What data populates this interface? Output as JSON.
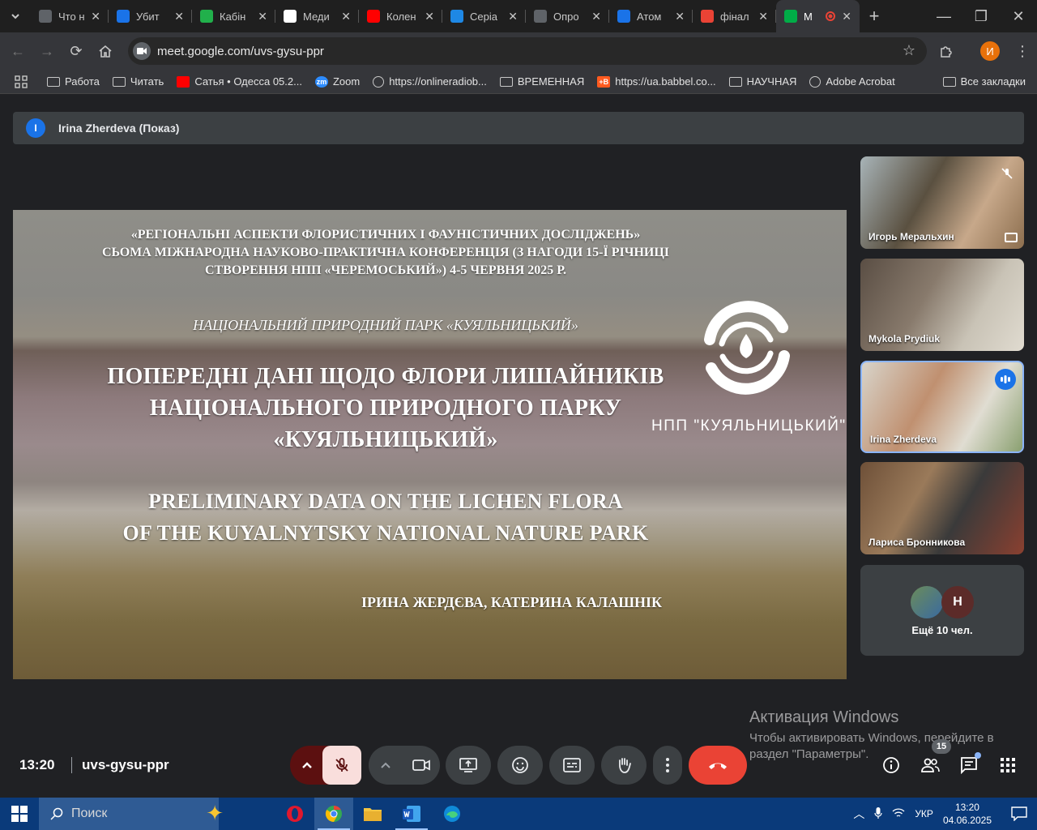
{
  "browser": {
    "tabs": [
      {
        "title": "Что н",
        "fav_color": "#5f6368"
      },
      {
        "title": "Убит",
        "fav_color": "#1a73e8"
      },
      {
        "title": "Кабін",
        "fav_color": "#21b04b"
      },
      {
        "title": "Меди",
        "fav_color": "#ffffff"
      },
      {
        "title": "Колен",
        "fav_color": "#ff0000"
      },
      {
        "title": "Серіа",
        "fav_color": "#1e88e5"
      },
      {
        "title": "Опро",
        "fav_color": "#5f6368"
      },
      {
        "title": "Атом",
        "fav_color": "#1a73e8"
      },
      {
        "title": "фінал",
        "fav_color": "#ea4335"
      },
      {
        "title": "М",
        "fav_color": "#00ac47"
      }
    ],
    "url": "meet.google.com/uvs-gysu-ppr",
    "profile_initial": "И",
    "bookmarks": [
      {
        "label": "Работа",
        "icon": "folder-icon"
      },
      {
        "label": "Читать",
        "icon": "folder-icon"
      },
      {
        "label": "Сатья • Одесса 05.2...",
        "icon": "youtube-icon",
        "color": "#ff0000"
      },
      {
        "label": "Zoom",
        "icon": "zoom-icon",
        "color": "#2d8cff",
        "badge": "zm"
      },
      {
        "label": "https://onlineradiob...",
        "icon": "radio-icon"
      },
      {
        "label": "ВРЕМЕННАЯ",
        "icon": "folder-icon"
      },
      {
        "label": "https://ua.babbel.co...",
        "icon": "babbel-icon",
        "color": "#ff5a1f",
        "badge": "+B"
      },
      {
        "label": "НАУЧНАЯ",
        "icon": "folder-icon"
      },
      {
        "label": "Adobe Acrobat",
        "icon": "globe-icon"
      }
    ],
    "all_bookmarks": "Все закладки"
  },
  "meet": {
    "presenter_initial": "I",
    "presenter_label": "Irina Zherdeva (Показ)",
    "slide": {
      "conference_lines": [
        "«РЕГІОНАЛЬНІ АСПЕКТИ ФЛОРИСТИЧНИХ І ФАУНІСТИЧНИХ ДОСЛІДЖЕНЬ»",
        "СЬОМА МІЖНАРОДНА НАУКОВО-ПРАКТИЧНА КОНФЕРЕНЦІЯ (З НАГОДИ 15-Ї РІЧНИЦІ",
        "СТВОРЕННЯ НПП «ЧЕРЕМОСЬКИЙ») 4-5 ЧЕРВНЯ 2025 Р."
      ],
      "park": "НАЦІОНАЛЬНИЙ ПРИРОДНИЙ ПАРК «КУЯЛЬНИЦЬКИЙ»",
      "title_ua": [
        "ПОПЕРЕДНІ ДАНІ ЩОДО ФЛОРИ ЛИШАЙНИКІВ",
        "НАЦІОНАЛЬНОГО ПРИРОДНОГО ПАРКУ",
        "«КУЯЛЬНИЦЬКИЙ»"
      ],
      "title_en": [
        "PRELIMINARY DATA ON THE LICHEN FLORA",
        "OF THE KUYALNYTSKY NATIONAL NATURE PARK"
      ],
      "authors": "ІРИНА ЖЕРДЄВА, КАТЕРИНА КАЛАШНІК",
      "logo_caption": "НПП \"КУЯЛЬНИЦЬКИЙ\""
    },
    "participants": [
      {
        "name": "Игорь Меральхин",
        "indicator": "mic-off-icon"
      },
      {
        "name": "Mykola Prydiuk",
        "indicator": ""
      },
      {
        "name": "Irina Zherdeva",
        "indicator": "speaking-icon"
      },
      {
        "name": "Лариса Бронникова",
        "indicator": ""
      }
    ],
    "more_participants": {
      "initial": "Н",
      "label": "Ещё 10 чел."
    },
    "time": "13:20",
    "code": "uvs-gysu-ppr",
    "people_count": "15",
    "colors": {
      "end_call": "#ea4335",
      "mic_off": "#f9dedc",
      "mic_off_arrow": "#5c1010",
      "accent": "#8ab4f8"
    }
  },
  "windows_activation": {
    "title": "Активация Windows",
    "text": "Чтобы активировать Windows, перейдите в раздел \"Параметры\"."
  },
  "taskbar": {
    "search_placeholder": "Поиск",
    "language": "УКР",
    "time": "13:20",
    "date": "04.06.2025"
  }
}
